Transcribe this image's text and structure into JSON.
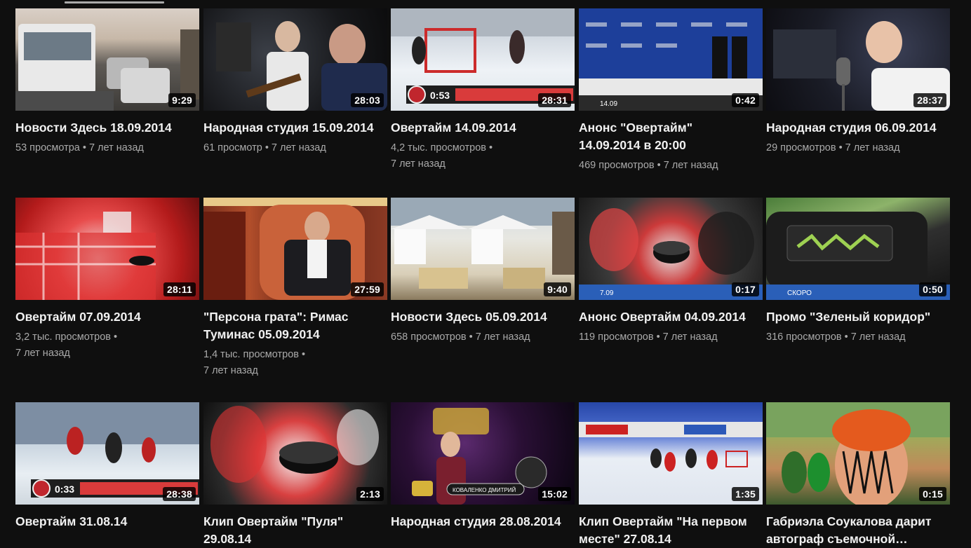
{
  "videos": [
    {
      "title": "Новости Здесь 18.09.2014",
      "views": "53 просмотра",
      "age": "7 лет назад",
      "duration": "9:29",
      "thumb": "traffic"
    },
    {
      "title": "Народная студия 15.09.2014",
      "views": "61 просмотр",
      "age": "7 лет назад",
      "duration": "28:03",
      "thumb": "studio"
    },
    {
      "title": "Овертайм 14.09.2014",
      "views": "4,2 тыс. просмотров",
      "age": "7 лет назад",
      "duration": "28:31",
      "thumb": "hockey"
    },
    {
      "title": "Анонс \"Овертайм\" 14.09.2014 в 20:00",
      "views": "469 просмотров",
      "age": "7 лет назад",
      "duration": "0:42",
      "thumb": "press"
    },
    {
      "title": "Народная студия 06.09.2014",
      "views": "29 просмотров",
      "age": "7 лет назад",
      "duration": "28:37",
      "thumb": "studio2"
    },
    {
      "title": "Овертайм 07.09.2014",
      "views": "3,2 тыс. просмотров",
      "age": "7 лет назад",
      "duration": "28:11",
      "thumb": "red"
    },
    {
      "title": "\"Персона грата\": Римас Туминас 05.09.2014",
      "views": "1,4 тыс. просмотров",
      "age": "7 лет назад",
      "duration": "27:59",
      "thumb": "persona"
    },
    {
      "title": "Новости Здесь 05.09.2014",
      "views": "658 просмотров",
      "age": "7 лет назад",
      "duration": "9:40",
      "thumb": "market"
    },
    {
      "title": "Анонс Овертайм 04.09.2014",
      "views": "119 просмотров",
      "age": "7 лет назад",
      "duration": "0:17",
      "thumb": "blur"
    },
    {
      "title": "Промо \"Зеленый коридор\"",
      "views": "316 просмотров",
      "age": "7 лет назад",
      "duration": "0:50",
      "thumb": "corridor"
    },
    {
      "title": "Овертайм 31.08.14",
      "views": "",
      "age": "",
      "duration": "28:38",
      "thumb": "rink2"
    },
    {
      "title": "Клип Овертайм \"Пуля\" 29.08.14",
      "views": "",
      "age": "",
      "duration": "2:13",
      "thumb": "puck"
    },
    {
      "title": "Народная студия 28.08.2014",
      "views": "",
      "age": "",
      "duration": "15:02",
      "thumb": "concert"
    },
    {
      "title": "Клип Овертайм \"На первом месте\" 27.08.14",
      "views": "",
      "age": "",
      "duration": "1:35",
      "thumb": "rink3"
    },
    {
      "title": "Габриэла Соукалова дарит автограф съемочной…",
      "views": "",
      "age": "",
      "duration": "0:15",
      "thumb": "fan"
    }
  ],
  "thumb_overlays": {
    "hockey_score": "0:53",
    "rink2_score": "0:33",
    "press_ticker": "14.09",
    "blur_ticker": "7.09",
    "corridor_ticker": "СКОРО",
    "concert_name": "КОВАЛЕНКО ДМИТРИЙ"
  }
}
